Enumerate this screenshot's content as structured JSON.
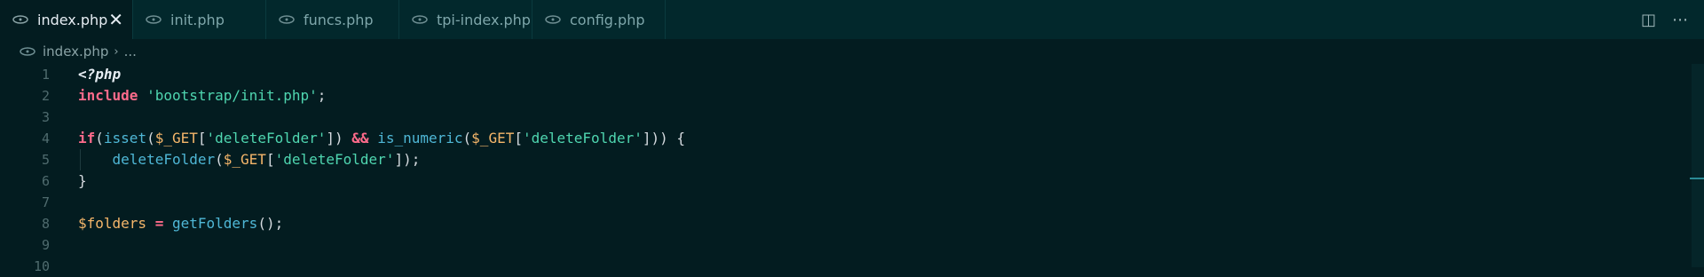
{
  "tabs": [
    {
      "label": "index.php",
      "active": true
    },
    {
      "label": "init.php",
      "active": false
    },
    {
      "label": "funcs.php",
      "active": false
    },
    {
      "label": "tpi-index.php",
      "active": false
    },
    {
      "label": "config.php",
      "active": false
    }
  ],
  "tab_close_glyph": "✕",
  "actions": {
    "split_glyph": "◫",
    "more_glyph": "⋯"
  },
  "breadcrumb": {
    "file": "index.php",
    "rest": "..."
  },
  "lines": {
    "n1": "1",
    "n2": "2",
    "n3": "3",
    "n4": "4",
    "n5": "5",
    "n6": "6",
    "n7": "7",
    "n8": "8",
    "n9": "9",
    "n10": "10",
    "l1": "<?php",
    "l2_kw": "include",
    "l2_str": "'bootstrap/init.php'",
    "l2_end": ";",
    "l4_if": "if",
    "l4_p1": "(",
    "l4_isset": "isset",
    "l4_p2": "(",
    "l4_var": "$_GET",
    "l4_b1": "[",
    "l4_s1": "'deleteFolder'",
    "l4_b2": "])",
    "l4_and": "&&",
    "l4_isnum": "is_numeric",
    "l4_p3": "(",
    "l4_var2": "$_GET",
    "l4_b3": "[",
    "l4_s2": "'deleteFolder'",
    "l4_end": "])) {",
    "l5_fn": "deleteFolder",
    "l5_p": "(",
    "l5_var": "$_GET",
    "l5_b": "[",
    "l5_s": "'deleteFolder'",
    "l5_end": "]);",
    "l6": "}",
    "l8_var": "$folders",
    "l8_eq": "=",
    "l8_fn": "getFolders",
    "l8_end": "();"
  },
  "colors": {
    "background": "#031c20",
    "tabbar": "#02282c",
    "keyword": "#ff6b8b",
    "string": "#4fd6b0",
    "function": "#4fb7d6",
    "variable": "#f5b66a"
  }
}
